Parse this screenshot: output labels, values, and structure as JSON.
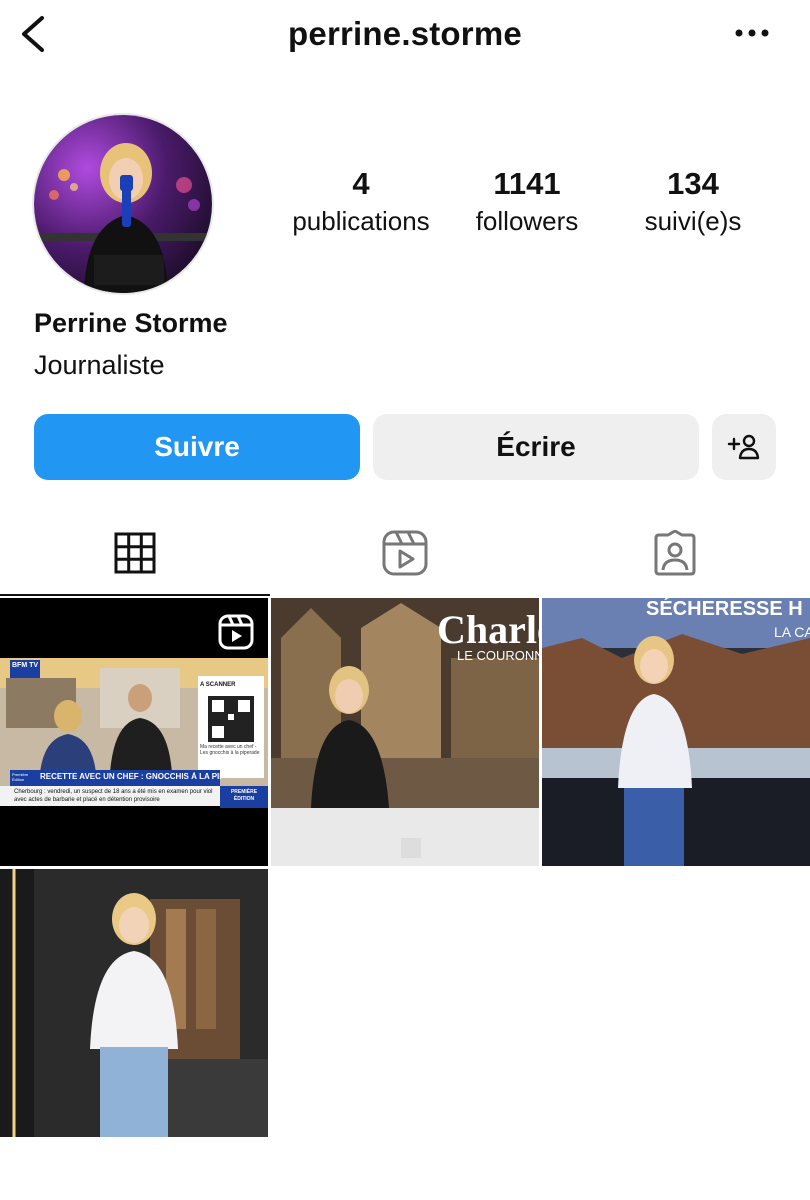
{
  "header": {
    "username": "perrine.storme"
  },
  "profile": {
    "stats": [
      {
        "value": "4",
        "label": "publications"
      },
      {
        "value": "1141",
        "label": "followers"
      },
      {
        "value": "134",
        "label": "suivi(e)s"
      }
    ],
    "full_name": "Perrine Storme",
    "bio": "Journaliste"
  },
  "actions": {
    "follow": "Suivre",
    "message": "Écrire",
    "add_icon": "person-add-icon"
  },
  "tabs": [
    {
      "icon": "grid-icon"
    },
    {
      "icon": "reels-icon"
    },
    {
      "icon": "tagged-icon"
    }
  ],
  "posts": {
    "post1": {
      "badge": "BFM TV",
      "qr_label": "A SCANNER",
      "qr_caption": "Ma recette avec un chef - Les gnocchis à la piperade",
      "headline": "RECETTE AVEC UN CHEF : GNOCCHIS À LA PIPERADE",
      "ticker": "Cherbourg : vendredi, un suspect de 18 ans a été mis en examen pour viol avec actes de barbarie et placé en détention provisoire",
      "edition": "PREMIÈRE ÉDITION",
      "program": "Première Édition"
    },
    "post2": {
      "title": "Charle",
      "subtitle": "LE COURONNE"
    },
    "post3": {
      "title": "SÉCHERESSE H",
      "subtitle": "LA CA"
    }
  },
  "colors": {
    "accent": "#2196f3",
    "secondary_bg": "#efefef"
  }
}
